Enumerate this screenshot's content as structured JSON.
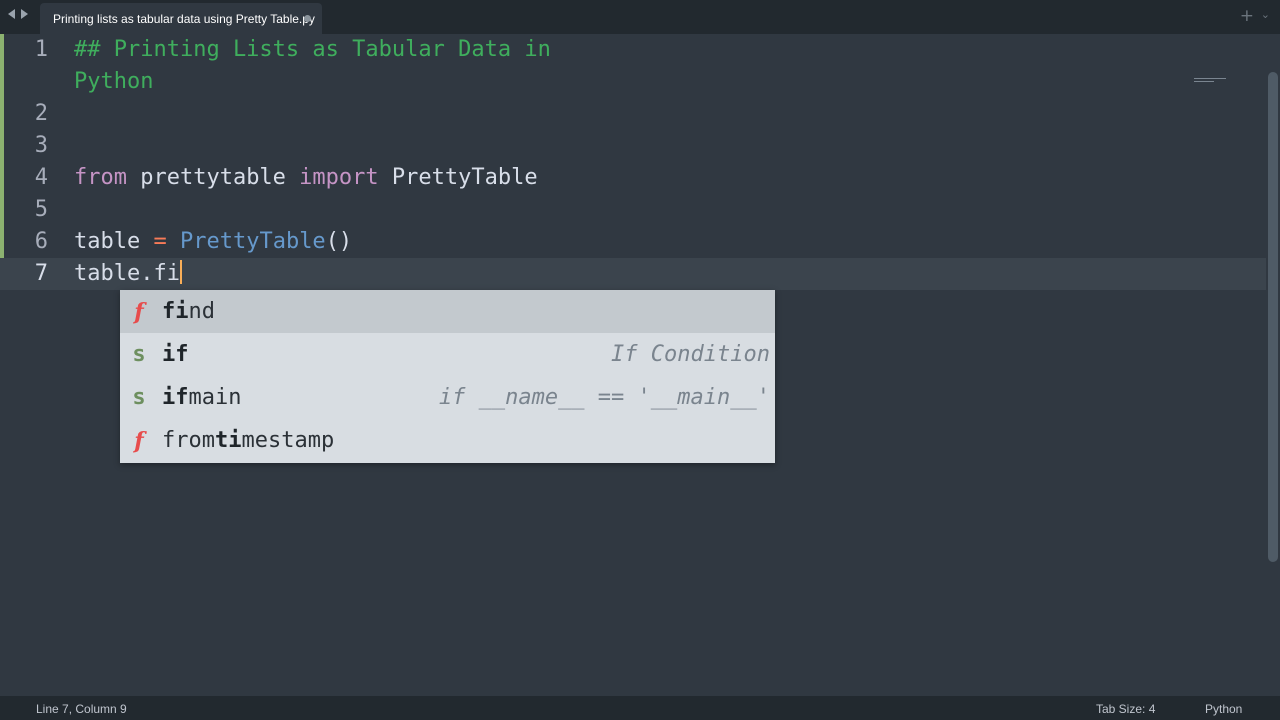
{
  "tab": {
    "title": "Printing lists as tabular data using Pretty Table.py",
    "plus": "+",
    "chevron": "⌄"
  },
  "nav": {
    "back": "back-arrow",
    "forward": "forward-arrow"
  },
  "editor": {
    "lines": {
      "l1": {
        "num": "1",
        "comment_a": "## Printing Lists as Tabular Data in",
        "comment_b": "Python"
      },
      "l2": {
        "num": "2"
      },
      "l3": {
        "num": "3"
      },
      "l4": {
        "num": "4",
        "kw1": "from",
        "mod": " prettytable ",
        "kw2": "import",
        "name": " PrettyTable"
      },
      "l5": {
        "num": "5"
      },
      "l6": {
        "num": "6",
        "var": "table ",
        "op": "=",
        "sp": " ",
        "fn": "PrettyTable",
        "paren": "()"
      },
      "l7": {
        "num": "7",
        "text": "table.fi"
      }
    }
  },
  "autocomplete": {
    "items": [
      {
        "kind": "f",
        "pre_bold": "fi",
        "rest": "nd",
        "hint": ""
      },
      {
        "kind": "s",
        "pre_bold": "if",
        "rest": "",
        "hint": "If Condition"
      },
      {
        "kind": "s",
        "pre_bold": "if",
        "rest": "main",
        "hint": "if __name__ == '__main__'"
      },
      {
        "kind": "f",
        "pre": "from",
        "mid_bold": "ti",
        "post": "mestamp",
        "hint": ""
      }
    ]
  },
  "status": {
    "position": "Line 7, Column 9",
    "tab_size": "Tab Size: 4",
    "syntax": "Python"
  },
  "colors": {
    "background": "#303841",
    "comment": "#3fae5d",
    "keyword": "#c594c5",
    "function": "#6699cc",
    "operator": "#f97b58",
    "cursor": "#f9ae58"
  }
}
